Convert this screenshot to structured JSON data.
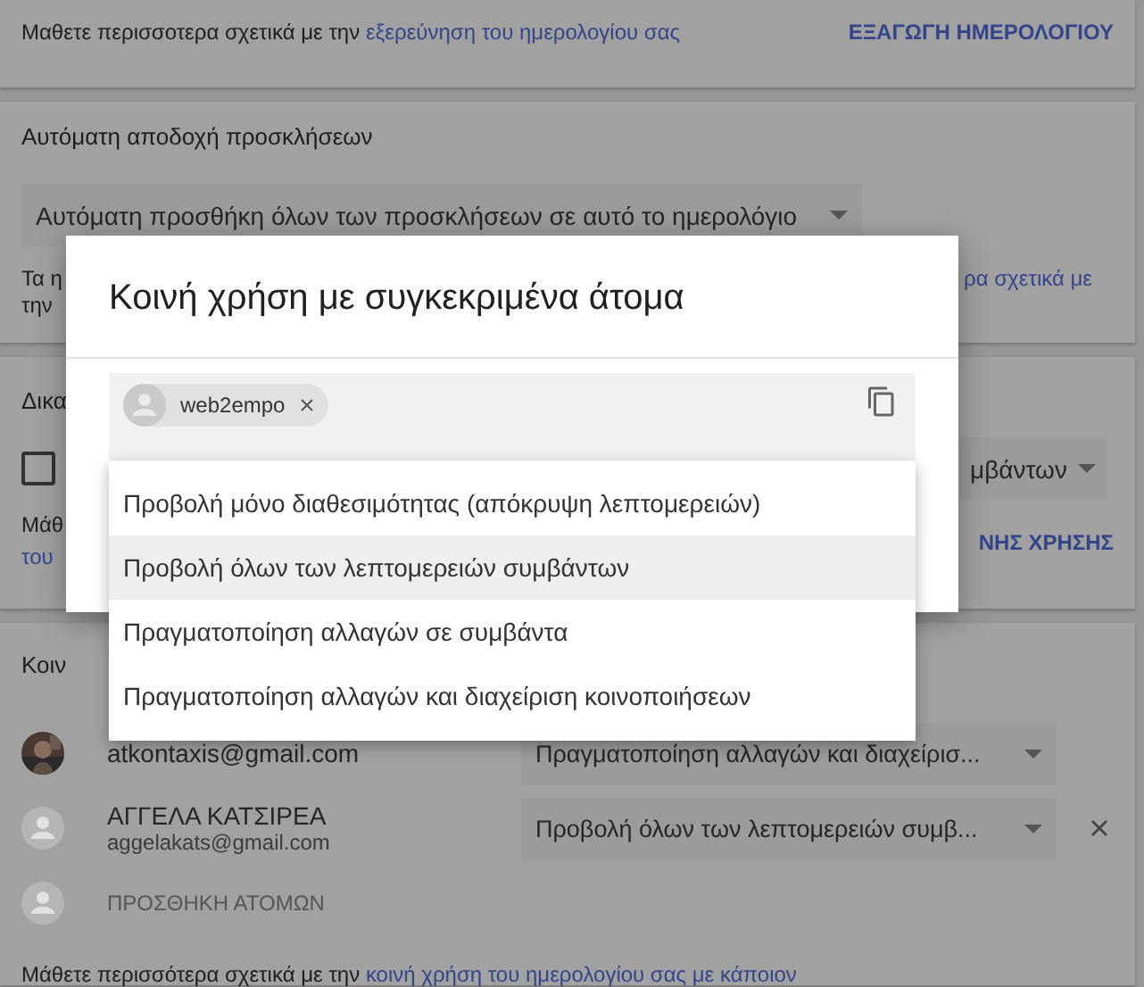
{
  "export_card": {
    "text": "Μαθετε περισσοτερα σχετικά με την ",
    "link": "εξερεύνηση του ημερολογίου σας",
    "button": "ΕΞΑΓΩΓΗ ΗΜΕΡΟΛΟΓΙΟΥ"
  },
  "invitations_card": {
    "heading": "Αυτόματη αποδοχή προσκλήσεων",
    "select": "Αυτόματη προσθήκη όλων των προσκλήσεων σε αυτό το ημερολόγιο",
    "note_left": [
      "Τα η",
      "την"
    ],
    "note_right": "ρα σχετικά με"
  },
  "permissions_card": {
    "heading": "Δικα",
    "checked": false,
    "select": "μβάντων",
    "note_left": [
      "Μάθ",
      "του"
    ],
    "link": "ΝΗΣ ΧΡΗΣΗΣ"
  },
  "sharing_card": {
    "heading": "Κοιν",
    "people": [
      {
        "email": "atkontaxis@gmail.com",
        "permission": "Πραγματοποίηση αλλαγών και διαχείρισ..."
      },
      {
        "kind": "generic",
        "name": "ΑΓΓΕΛΑ ΚΑΤΣΙΡΕΑ",
        "email": "aggelakats@gmail.com",
        "permission": "Προβολή όλων των λεπτομερειών συμβ..."
      }
    ],
    "add_people": "ΠΡΟΣΘΗΚΗ ΑΤΟΜΩΝ",
    "footer_text": "Μάθετε περισσότερα σχετικά με την ",
    "footer_link": "κοινή χρήση του ημερολογίου σας με κάποιον"
  },
  "dialog": {
    "title": "Κοινή χρήση με συγκεκριμένα άτομα",
    "chips": [
      {
        "label": "web2empo"
      }
    ],
    "menu": [
      {
        "label": "Προβολή μόνο διαθεσιμότητας (απόκρυψη λεπτομερειών)",
        "selected": false
      },
      {
        "label": "Προβολή όλων των λεπτομερειών συμβάντων",
        "selected": true
      },
      {
        "label": "Πραγματοποίηση αλλαγών σε συμβάντα",
        "selected": false
      },
      {
        "label": "Πραγματοποίηση αλλαγών και διαχείριση κοινοποιήσεων",
        "selected": false
      }
    ]
  }
}
